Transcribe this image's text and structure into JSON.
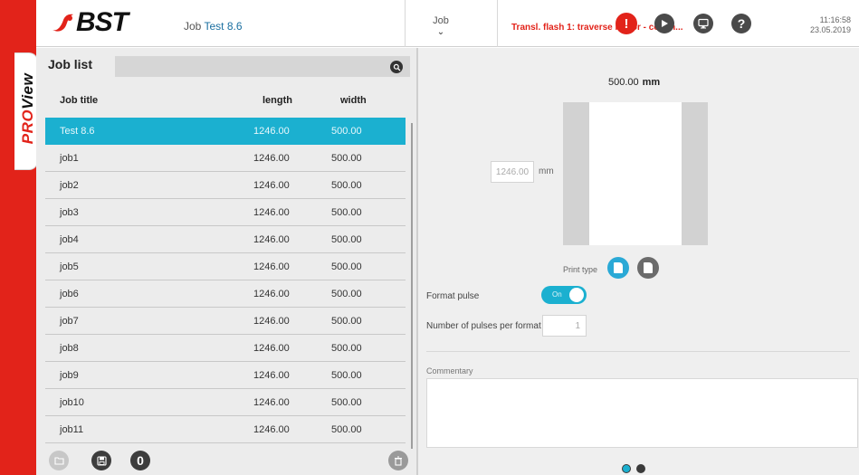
{
  "brand": {
    "logo_text": "BST",
    "side_tab_pro": "PRO",
    "side_tab_view": "View",
    "accent_color": "#1bb0d0",
    "alarm_color": "#e2231a"
  },
  "header": {
    "job_prefix": "Job",
    "job_name": "Test 8.6",
    "job_menu_label": "Job",
    "alarm_message": "Transl. flash 1: traverse motor - comm...",
    "time": "11:16:58",
    "date": "23.05.2019"
  },
  "job_list": {
    "title": "Job list",
    "search_value": "",
    "columns": [
      "Job title",
      "length",
      "width"
    ],
    "rows": [
      {
        "title": "Test 8.6",
        "length": "1246.00",
        "width": "500.00",
        "selected": true
      },
      {
        "title": "job1",
        "length": "1246.00",
        "width": "500.00"
      },
      {
        "title": "job2",
        "length": "1246.00",
        "width": "500.00"
      },
      {
        "title": "job3",
        "length": "1246.00",
        "width": "500.00"
      },
      {
        "title": "job4",
        "length": "1246.00",
        "width": "500.00"
      },
      {
        "title": "job5",
        "length": "1246.00",
        "width": "500.00"
      },
      {
        "title": "job6",
        "length": "1246.00",
        "width": "500.00"
      },
      {
        "title": "job7",
        "length": "1246.00",
        "width": "500.00"
      },
      {
        "title": "job8",
        "length": "1246.00",
        "width": "500.00"
      },
      {
        "title": "job9",
        "length": "1246.00",
        "width": "500.00"
      },
      {
        "title": "job10",
        "length": "1246.00",
        "width": "500.00"
      },
      {
        "title": "job11",
        "length": "1246.00",
        "width": "500.00"
      }
    ],
    "zero_button_label": "0"
  },
  "job_detail": {
    "width_value": "500.00",
    "width_unit": "mm",
    "length_value": "1246.00",
    "length_unit": "mm",
    "print_type_label": "Print type",
    "format_pulse_label": "Format pulse",
    "format_pulse_toggle_text": "On",
    "pulses_label": "Number of pulses per format",
    "pulses_value": "1",
    "commentary_label": "Commentary",
    "commentary_value": ""
  }
}
